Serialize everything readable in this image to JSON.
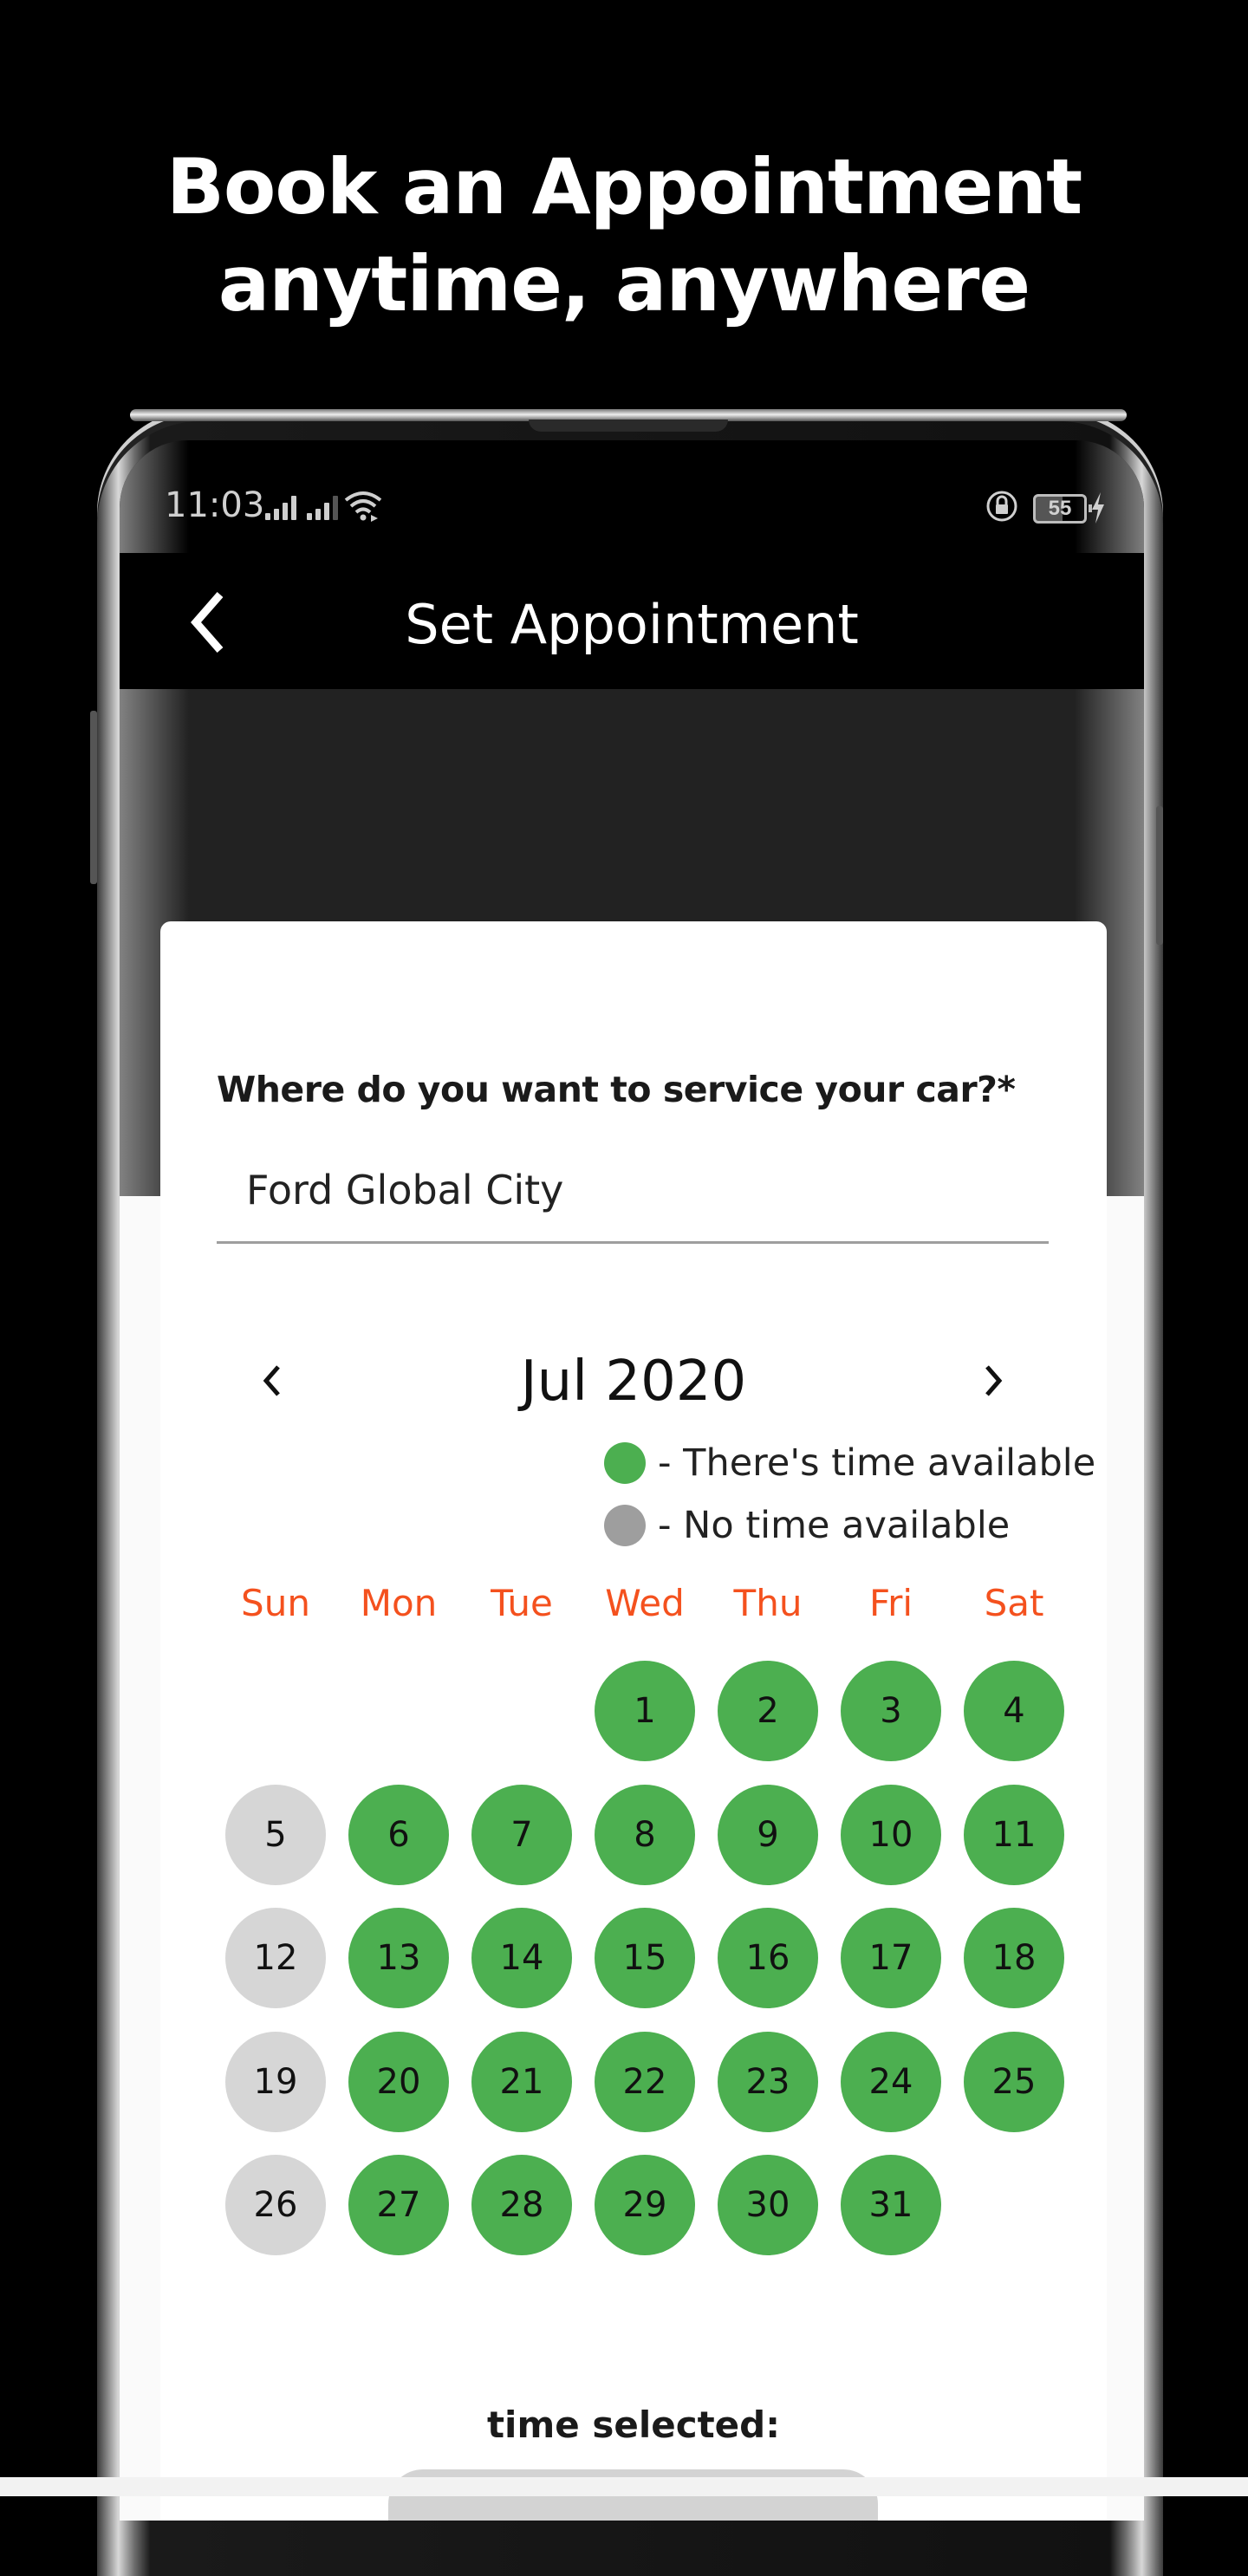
{
  "promo": {
    "headline_line1": "Book an Appointment",
    "headline_line2": "anytime, anywhere"
  },
  "status_bar": {
    "time": "11:03",
    "icons": [
      "signal-icon",
      "signal-icon",
      "wifi-icon",
      "rotation-lock-icon",
      "battery-icon",
      "charging-icon"
    ],
    "battery_level": "55"
  },
  "app_bar": {
    "back_icon": "chevron-left-icon",
    "title": "Set Appointment"
  },
  "form": {
    "location_label": "Where do you want to service your car?*",
    "location_value": "Ford Global City"
  },
  "calendar": {
    "month_label": "Jul 2020",
    "prev_icon": "chevron-left-icon",
    "next_icon": "chevron-right-icon",
    "legend": [
      {
        "label": "- There's time available",
        "color": "#4caf50"
      },
      {
        "label": "- No time available",
        "color": "#9e9e9e"
      }
    ],
    "weekdays": [
      "Sun",
      "Mon",
      "Tue",
      "Wed",
      "Thu",
      "Fri",
      "Sat"
    ],
    "first_weekday_index": 3,
    "days": [
      {
        "day": "1",
        "available": true
      },
      {
        "day": "2",
        "available": true
      },
      {
        "day": "3",
        "available": true
      },
      {
        "day": "4",
        "available": true
      },
      {
        "day": "5",
        "available": false
      },
      {
        "day": "6",
        "available": true
      },
      {
        "day": "7",
        "available": true
      },
      {
        "day": "8",
        "available": true
      },
      {
        "day": "9",
        "available": true
      },
      {
        "day": "10",
        "available": true
      },
      {
        "day": "11",
        "available": true
      },
      {
        "day": "12",
        "available": false
      },
      {
        "day": "13",
        "available": true
      },
      {
        "day": "14",
        "available": true
      },
      {
        "day": "15",
        "available": true
      },
      {
        "day": "16",
        "available": true
      },
      {
        "day": "17",
        "available": true
      },
      {
        "day": "18",
        "available": true
      },
      {
        "day": "19",
        "available": false
      },
      {
        "day": "20",
        "available": true
      },
      {
        "day": "21",
        "available": true
      },
      {
        "day": "22",
        "available": true
      },
      {
        "day": "23",
        "available": true
      },
      {
        "day": "24",
        "available": true
      },
      {
        "day": "25",
        "available": true
      },
      {
        "day": "26",
        "available": false
      },
      {
        "day": "27",
        "available": true
      },
      {
        "day": "28",
        "available": true
      },
      {
        "day": "29",
        "available": true
      },
      {
        "day": "30",
        "available": true
      },
      {
        "day": "31",
        "available": true
      }
    ],
    "colors": {
      "available": "#4caf50",
      "unavailable": "#d6d6d6",
      "weekday_text": "#f4511e"
    }
  },
  "time_selection": {
    "label": "time selected:"
  }
}
